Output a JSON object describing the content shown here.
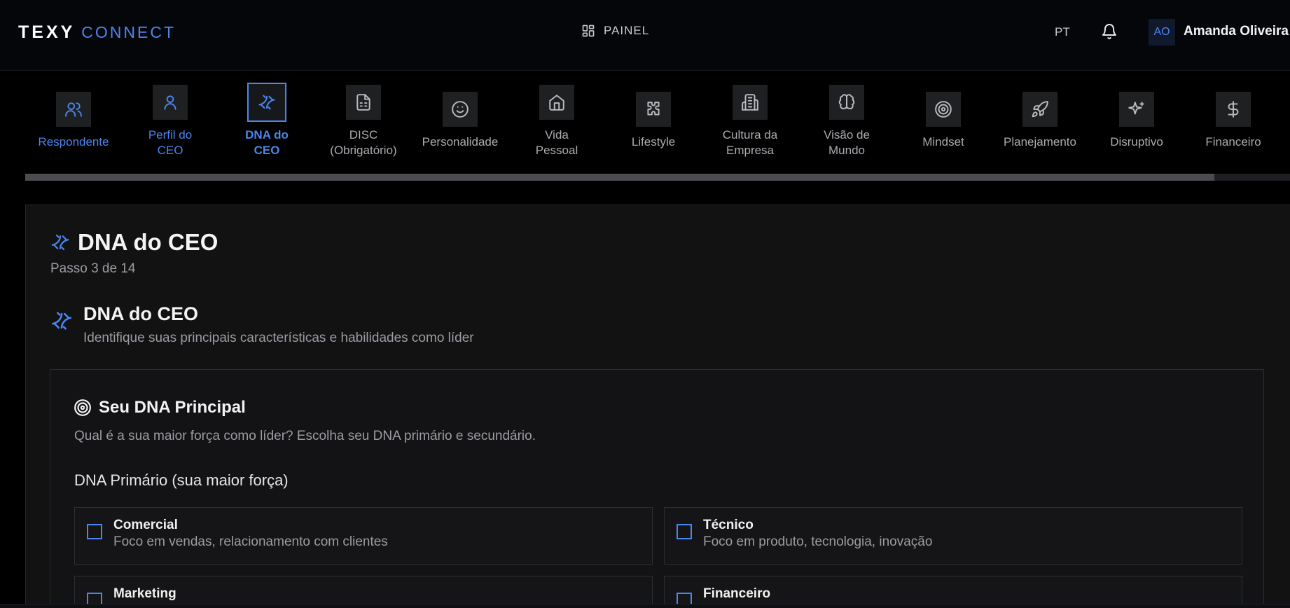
{
  "header": {
    "logo_primary": "TEXY",
    "logo_secondary": "CONNECT",
    "nav_label": "PAINEL",
    "language": "PT",
    "user_initials": "AO",
    "user_name": "Amanda Oliveira"
  },
  "steps": [
    {
      "label": "Respondente",
      "icon": "users-icon",
      "state": "done"
    },
    {
      "label": "Perfil do CEO",
      "icon": "user-icon",
      "state": "done"
    },
    {
      "label": "DNA do CEO",
      "icon": "dna-icon",
      "state": "active"
    },
    {
      "label": "DISC (Obrigatório)",
      "icon": "document-icon",
      "state": "pending"
    },
    {
      "label": "Personalidade",
      "icon": "smile-icon",
      "state": "pending"
    },
    {
      "label": "Vida Pessoal",
      "icon": "home-icon",
      "state": "pending"
    },
    {
      "label": "Lifestyle",
      "icon": "puzzle-icon",
      "state": "pending"
    },
    {
      "label": "Cultura da Empresa",
      "icon": "building-icon",
      "state": "pending"
    },
    {
      "label": "Visão de Mundo",
      "icon": "brain-icon",
      "state": "pending"
    },
    {
      "label": "Mindset",
      "icon": "target-icon",
      "state": "pending"
    },
    {
      "label": "Planejamento",
      "icon": "rocket-icon",
      "state": "pending"
    },
    {
      "label": "Disruptivo",
      "icon": "sparkles-icon",
      "state": "pending"
    },
    {
      "label": "Financeiro",
      "icon": "dollar-icon",
      "state": "pending"
    }
  ],
  "progress_percent": 94,
  "page": {
    "title": "DNA do CEO",
    "step_text": "Passo 3 de 14",
    "section_title": "DNA do CEO",
    "section_desc": "Identifique suas principais características e habilidades como líder"
  },
  "card": {
    "title": "Seu DNA Principal",
    "desc": "Qual é a sua maior força como líder? Escolha seu DNA primário e secundário.",
    "group_label": "DNA Primário (sua maior força)",
    "options": [
      {
        "title": "Comercial",
        "desc": "Foco em vendas, relacionamento com clientes"
      },
      {
        "title": "Técnico",
        "desc": "Foco em produto, tecnologia, inovação"
      },
      {
        "title": "Marketing",
        "desc": ""
      },
      {
        "title": "Financeiro",
        "desc": ""
      }
    ]
  },
  "colors": {
    "accent": "#4b86ee",
    "background": "#000000",
    "panel": "#121213"
  }
}
